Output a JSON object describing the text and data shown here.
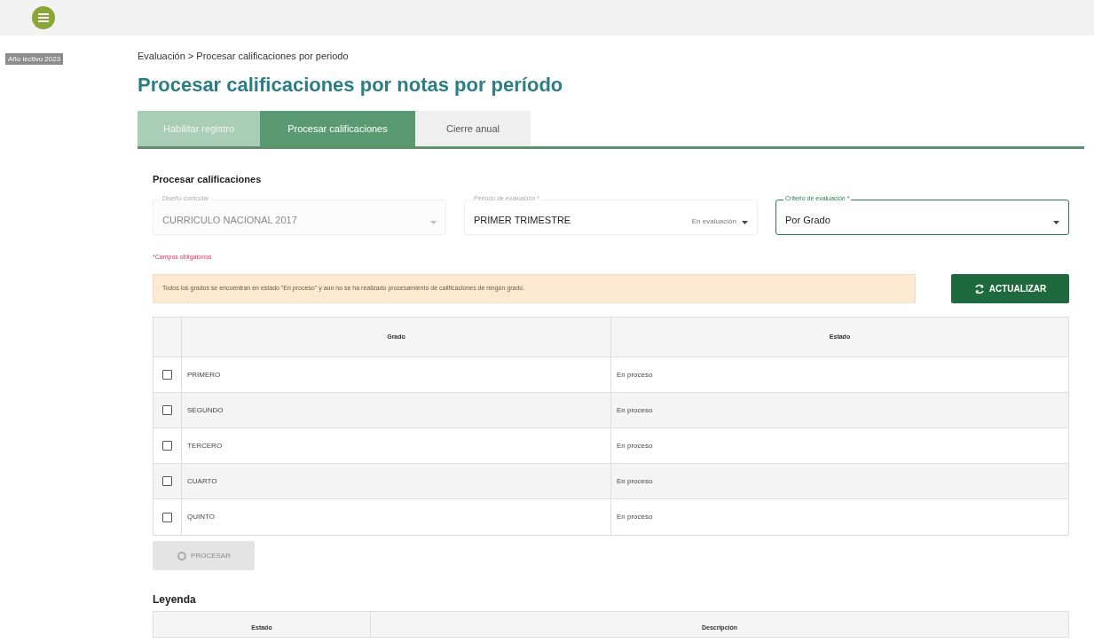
{
  "side_tag": "Año lectivo 2023",
  "breadcrumb": "Evaluación > Procesar calificaciones por periodo",
  "title": "Procesar calificaciones por notas por período",
  "tabs": [
    {
      "label": "Habilitar registro",
      "selected": false,
      "disabled": true
    },
    {
      "label": "Procesar calificaciones",
      "selected": true,
      "disabled": false
    },
    {
      "label": "Cierre anual",
      "selected": false,
      "disabled": false
    }
  ],
  "section_title": "Procesar calificaciones",
  "fields": [
    {
      "label": "Diseño curricular",
      "value": "CURRICULO NACIONAL 2017",
      "disabled": true,
      "focused": false
    },
    {
      "label": "Periodo de evaluación *",
      "value": "PRIMER TRIMESTRE",
      "tag": "En evaluación",
      "disabled": false,
      "focused": false
    },
    {
      "label": "Criterio de evaluación *",
      "value": "Por Grado",
      "disabled": false,
      "focused": true
    }
  ],
  "required_note": "*Campos obligatorios",
  "alert": "Todos los grados se encuentran en estado \"En proceso\" y aún no se ha realizado procesamiento de calificaciones de ningún grado.",
  "refresh_button": "ACTUALIZAR",
  "table": {
    "columns": [
      "Grado",
      "Estado"
    ],
    "rows": [
      {
        "grado": "PRIMERO",
        "estado": "En proceso",
        "checked": false
      },
      {
        "grado": "SEGUNDO",
        "estado": "En proceso",
        "checked": false
      },
      {
        "grado": "TERCERO",
        "estado": "En proceso",
        "checked": false
      },
      {
        "grado": "CUARTO",
        "estado": "En proceso",
        "checked": false
      },
      {
        "grado": "QUINTO",
        "estado": "En proceso",
        "checked": false
      }
    ]
  },
  "process_button": {
    "label": "PROCESAR",
    "disabled": true
  },
  "legend": {
    "title": "Leyenda",
    "columns": [
      "Estado",
      "Descripción"
    ]
  }
}
